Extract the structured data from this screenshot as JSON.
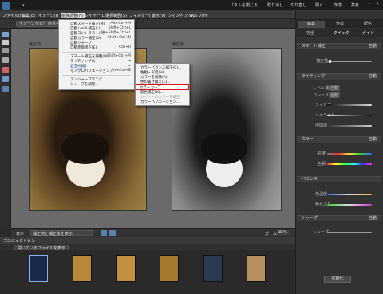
{
  "titlebar": {
    "items": [
      "パネルを閉じる",
      "取り消し",
      "やり直し",
      "開く",
      "作成",
      "共有"
    ]
  },
  "menubar": {
    "items": [
      "ファイル(F)",
      "編集(E)",
      "イメージ(I)",
      "画質調整(N)",
      "レイヤー(L)",
      "選択範囲(S)",
      "フィルター(T)",
      "表示(V)",
      "ウィンドウ(W)",
      "ヘルプ(H)"
    ]
  },
  "toolbar": {
    "left_button": "イメージを表示",
    "right_button": "画質を調整"
  },
  "canvas": {
    "before_label": "補正前",
    "after_label": "補正後"
  },
  "status": {
    "view_label": "表示",
    "view_value": "補正前と補正後を表示",
    "zoom_label": "ズーム",
    "zoom_value": "45%"
  },
  "bin": {
    "title": "プロジェクトビン",
    "filter": "開いているファイルを表示"
  },
  "panel": {
    "tabs": [
      "編集",
      "作成",
      "配信"
    ],
    "subtabs": [
      "完全",
      "クイック",
      "ガイド"
    ],
    "sections": [
      {
        "title": "スマート補正",
        "reset": "自動",
        "rows": [
          "補正量"
        ]
      },
      {
        "title": "ライティング",
        "reset": "自動",
        "rows": [
          "レベル補正",
          "コントラスト",
          "シャドウ",
          "ハイライト",
          "中間調"
        ]
      },
      {
        "title": "カラー",
        "reset": "自動",
        "rows": [
          "彩度",
          "色相"
        ]
      },
      {
        "title": "バランス",
        "reset": "",
        "rows": [
          "色温度",
          "色かぶり"
        ]
      },
      {
        "title": "シャープ",
        "reset": "自動",
        "rows": [
          "シャープ"
        ]
      }
    ],
    "auto_label": "自動",
    "reset_button": "初期化"
  },
  "menu1": {
    "items": [
      {
        "label": "自動スマート補正(M)",
        "shortcut": "Alt+Ctrl+M"
      },
      {
        "label": "自動レベル補正(L)",
        "shortcut": "Shift+Ctrl+L"
      },
      {
        "label": "自動コントラスト(U)",
        "shortcut": "Alt+Shift+Ctrl+L"
      },
      {
        "label": "自動カラー補正(O)",
        "shortcut": "Shift+Ctrl+B"
      },
      {
        "label": "自動シャープ",
        "shortcut": ""
      },
      {
        "label": "自動赤目修正(E)",
        "shortcut": "Ctrl+R"
      },
      {
        "label": "スマート補正を調整(M)...",
        "shortcut": "Shift+Ctrl+M"
      },
      {
        "label": "ライティング(I)",
        "shortcut": ""
      },
      {
        "label": "カラー(C)",
        "shortcut": ""
      },
      {
        "label": "モノクロバリエーション...",
        "shortcut": "Alt+Ctrl+B"
      },
      {
        "label": "アンシャープマスク...",
        "shortcut": ""
      },
      {
        "label": "シャープを調整...",
        "shortcut": ""
      }
    ]
  },
  "menu2": {
    "items": [
      "カラーバランス補正(C)...",
      "色相・彩度(H)...",
      "カラーを削除(R)",
      "色の置き換え(E)...",
      "カラーカーブ...",
      "肌色補正(K)...",
      "レイヤーのカラーを補正",
      "カラーバリエーション..."
    ],
    "highlight_index": 4
  }
}
